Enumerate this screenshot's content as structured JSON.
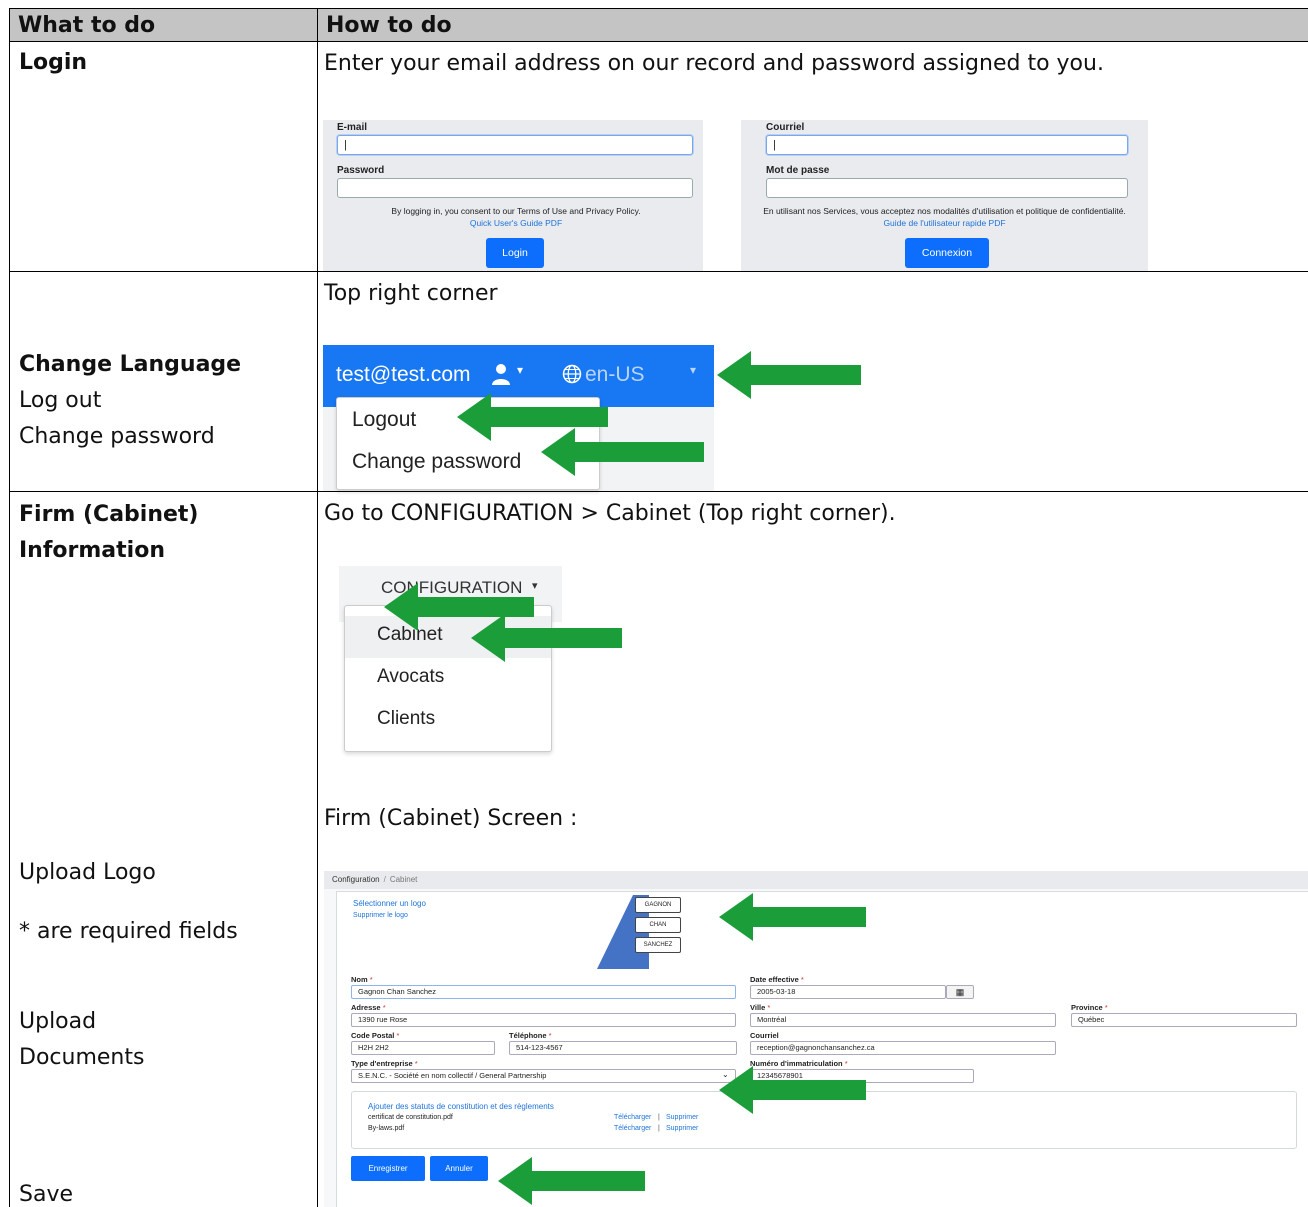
{
  "header": {
    "col1": "What to do",
    "col2": "How to do"
  },
  "row_login": {
    "label": "Login",
    "description": "Enter your email address on our record and password assigned to you.",
    "en": {
      "email_label": "E-mail",
      "email_value": "|",
      "password_label": "Password",
      "note": "By logging in, you consent to our Terms of Use and Privacy Policy.",
      "guide_link": "Quick User's Guide PDF",
      "button": "Login"
    },
    "fr": {
      "email_label": "Courriel",
      "email_value": "|",
      "password_label": "Mot de passe",
      "note": "En utilisant nos Services, vous acceptez nos modalités d'utilisation et politique de confidentialité.",
      "guide_link": "Guide de l'utilisateur rapide PDF",
      "button": "Connexion"
    }
  },
  "row_language": {
    "label_change_language": "Change Language",
    "label_logout": "Log out",
    "label_change_password": "Change password",
    "description": "Top right corner",
    "navbar": {
      "email": "test@test.com",
      "language": "en-US"
    },
    "menu": [
      "Logout",
      "Change password"
    ]
  },
  "row_firm": {
    "label_line1": "Firm (Cabinet)",
    "label_line2": "Information",
    "description": "Go to CONFIGURATION > Cabinet (Top right corner).",
    "config_menu": {
      "title": "CONFIGURATION",
      "items": [
        "Cabinet",
        "Avocats",
        "Clients"
      ]
    },
    "screen_caption": "Firm (Cabinet) Screen :",
    "label_upload_logo": "Upload Logo",
    "label_required": "* are required fields",
    "label_upload_docs_1": "Upload",
    "label_upload_docs_2": "Documents",
    "label_save": "Save",
    "screen": {
      "crumb_root": "Configuration",
      "crumb_current": "Cabinet",
      "select_logo": "Sélectionner un logo",
      "remove_logo": "Supprimer le logo",
      "logo_words": [
        "GAGNON",
        "CHAN",
        "SANCHEZ"
      ],
      "nom_label": "Nom",
      "nom_value": "Gagnon Chan Sanchez",
      "date_label": "Date effective",
      "date_value": "2005-03-18",
      "adresse_label": "Adresse",
      "adresse_value": "1390 rue Rose",
      "ville_label": "Ville",
      "ville_value": "Montréal",
      "province_label": "Province",
      "province_value": "Québec",
      "code_label": "Code Postal",
      "code_value": "H2H 2H2",
      "tel_label": "Téléphone",
      "tel_value": "514-123-4567",
      "courriel_label": "Courriel",
      "courriel_value": "reception@gagnonchansanchez.ca",
      "type_label": "Type d'entreprise",
      "type_value": "S.E.N.C. - Société en nom collectif / General Partnership",
      "immat_label": "Numéro d'immatriculation",
      "immat_value": "12345678901",
      "docs_add": "Ajouter des statuts de constitution et des règlements",
      "docs": [
        {
          "name": "certificat de constitution.pdf",
          "download": "Télécharger",
          "remove": "Supprimer"
        },
        {
          "name": "By-laws.pdf",
          "download": "Télécharger",
          "remove": "Supprimer"
        }
      ],
      "save_button": "Enregistrer",
      "cancel_button": "Annuler"
    }
  }
}
